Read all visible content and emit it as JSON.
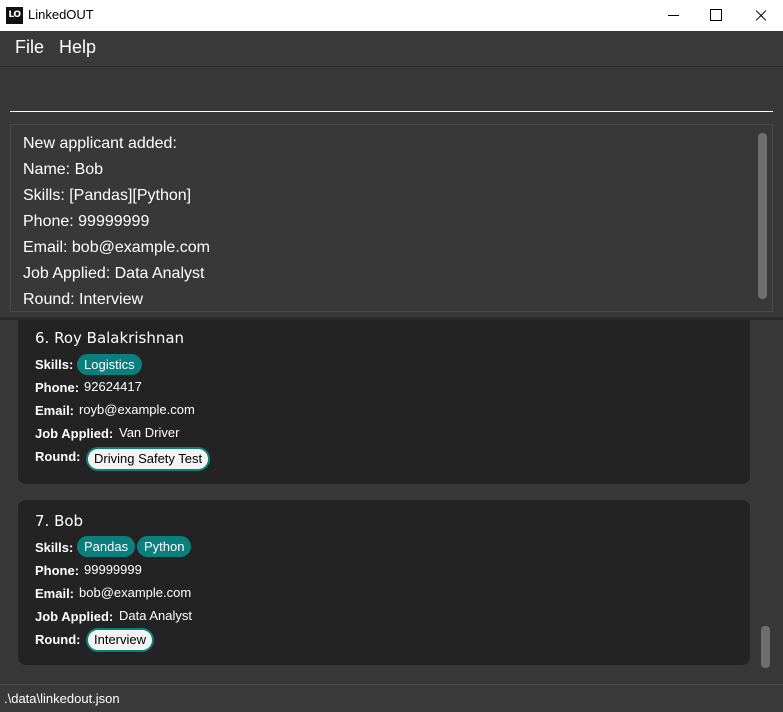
{
  "window": {
    "icon_text": "LO",
    "title": "LinkedOUT"
  },
  "menu": {
    "file": "File",
    "help": "Help"
  },
  "command": {
    "value": ""
  },
  "result": {
    "lines": [
      "New applicant added:",
      "Name: Bob",
      "Skills: [Pandas][Python]",
      "Phone: 99999999",
      "Email: bob@example.com",
      "Job Applied: Data Analyst",
      "Round: Interview"
    ]
  },
  "labels": {
    "skills": "Skills:",
    "phone": "Phone:",
    "email": "Email:",
    "job": "Job Applied:",
    "round": "Round:"
  },
  "applicants": [
    {
      "name": "6.  Roy Balakrishnan",
      "skills": [
        "Logistics"
      ],
      "phone": "92624417",
      "email": "royb@example.com",
      "job": "Van Driver",
      "round": "Driving Safety Test"
    },
    {
      "name": "7.  Bob",
      "skills": [
        "Pandas",
        "Python"
      ],
      "phone": "99999999",
      "email": "bob@example.com",
      "job": "Data Analyst",
      "round": "Interview"
    }
  ],
  "status": {
    "path": ".\\data\\linkedout.json"
  },
  "colors": {
    "tag": "#0b7e7e",
    "card": "#232323",
    "background": "#383838"
  }
}
